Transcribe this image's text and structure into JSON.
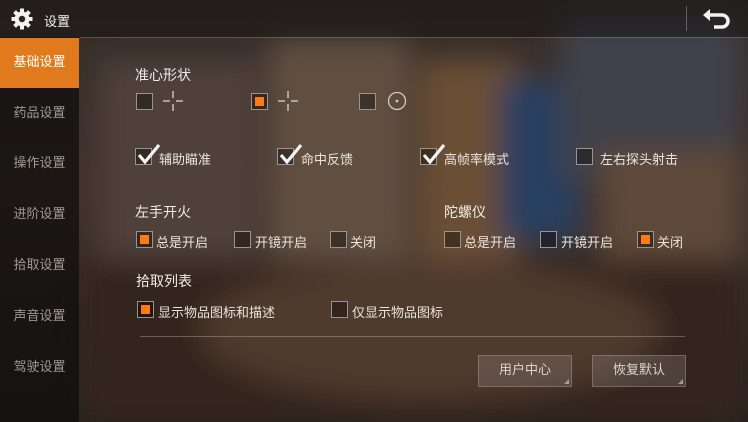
{
  "header": {
    "title": "设置"
  },
  "sidebar": {
    "items": [
      {
        "label": "基础设置",
        "active": true
      },
      {
        "label": "药品设置"
      },
      {
        "label": "操作设置"
      },
      {
        "label": "进阶设置"
      },
      {
        "label": "拾取设置"
      },
      {
        "label": "声音设置"
      },
      {
        "label": "驾驶设置"
      }
    ]
  },
  "crosshair": {
    "title": "准心形状",
    "options": [
      {
        "icon": "crosshair-plus-icon",
        "selected": false
      },
      {
        "icon": "crosshair-plus-icon",
        "selected": true
      },
      {
        "icon": "crosshair-dot-icon",
        "selected": false
      }
    ]
  },
  "toggles": [
    {
      "label": "辅助瞄准",
      "checked": true
    },
    {
      "label": "命中反馈",
      "checked": true
    },
    {
      "label": "高帧率模式",
      "checked": true
    },
    {
      "label": "左右探头射击",
      "checked": false
    }
  ],
  "left_fire": {
    "title": "左手开火",
    "options": [
      {
        "label": "总是开启",
        "selected": true
      },
      {
        "label": "开镜开启",
        "selected": false
      },
      {
        "label": "关闭",
        "selected": false
      }
    ]
  },
  "gyro": {
    "title": "陀螺仪",
    "options": [
      {
        "label": "总是开启",
        "selected": false
      },
      {
        "label": "开镜开启",
        "selected": false
      },
      {
        "label": "关闭",
        "selected": true
      }
    ]
  },
  "pickup_list": {
    "title": "拾取列表",
    "options": [
      {
        "label": "显示物品图标和描述",
        "selected": true
      },
      {
        "label": "仅显示物品图标",
        "selected": false
      }
    ]
  },
  "buttons": {
    "user_center": "用户中心",
    "restore_default": "恢复默认"
  },
  "colors": {
    "accent": "#e07a1c",
    "selected_fill": "#ff7a12"
  }
}
